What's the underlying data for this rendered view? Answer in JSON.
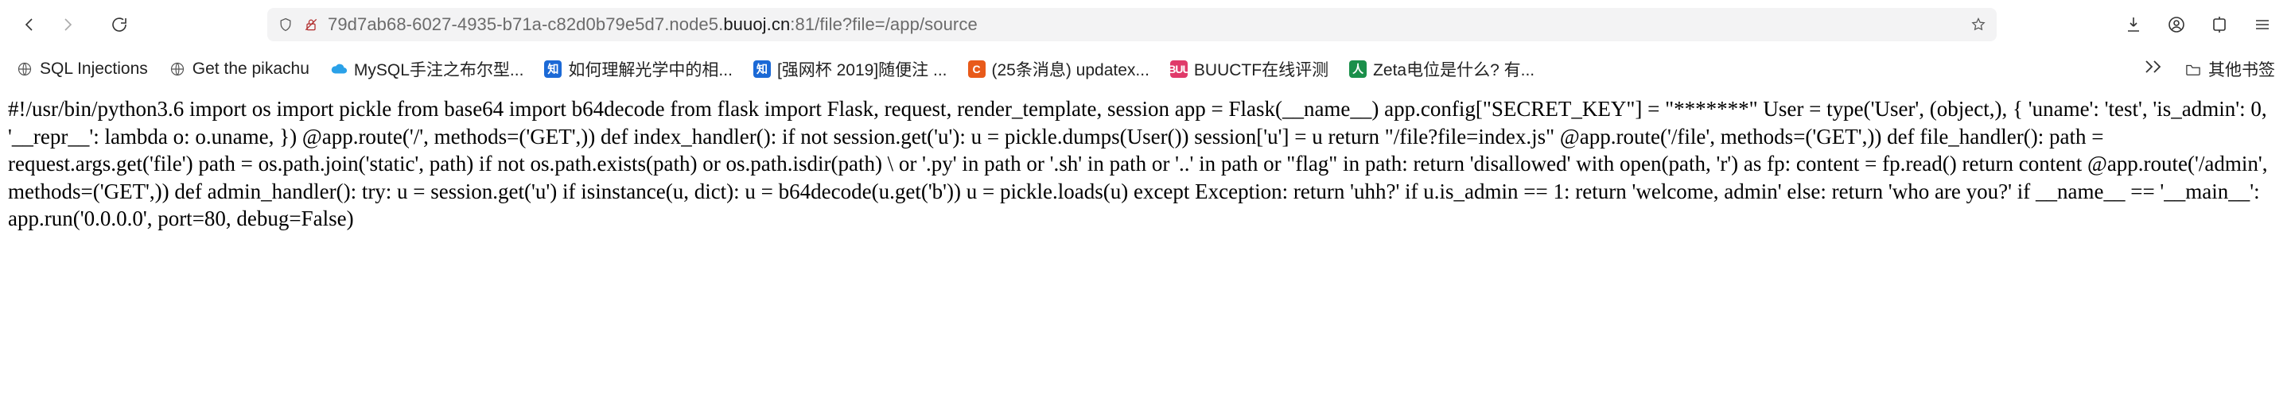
{
  "url": {
    "pre_host": "79d7ab68-6027-4935-b71a-c82d0b79e5d7.node5.",
    "host": "buuoj.cn",
    "post_host": ":81/file?file=/app/source"
  },
  "bookmarks": [
    {
      "label": "SQL Injections",
      "favicon": "globe"
    },
    {
      "label": "Get the pikachu",
      "favicon": "globe"
    },
    {
      "label": "MySQL手注之布尔型...",
      "favicon": "cloud"
    },
    {
      "label": "如何理解光学中的相...",
      "favicon": "blue",
      "glyph": "知"
    },
    {
      "label": "[强网杯 2019]随便注 ...",
      "favicon": "blue",
      "glyph": "知"
    },
    {
      "label": "(25条消息) updatex...",
      "favicon": "orange",
      "glyph": "C"
    },
    {
      "label": "BUUCTF在线评测",
      "favicon": "pink",
      "glyph": "BUU"
    },
    {
      "label": "Zeta电位是什么? 有...",
      "favicon": "green",
      "glyph": "人"
    }
  ],
  "other_bookmarks_label": "其他书签",
  "page_body": "#!/usr/bin/python3.6 import os import pickle from base64 import b64decode from flask import Flask, request, render_template, session app = Flask(__name__) app.config[\"SECRET_KEY\"] = \"*******\" User = type('User', (object,), { 'uname': 'test', 'is_admin': 0, '__repr__': lambda o: o.uname, }) @app.route('/', methods=('GET',)) def index_handler(): if not session.get('u'): u = pickle.dumps(User()) session['u'] = u return \"/file?file=index.js\" @app.route('/file', methods=('GET',)) def file_handler(): path = request.args.get('file') path = os.path.join('static', path) if not os.path.exists(path) or os.path.isdir(path) \\ or '.py' in path or '.sh' in path or '..' in path or \"flag\" in path: return 'disallowed' with open(path, 'r') as fp: content = fp.read() return content @app.route('/admin', methods=('GET',)) def admin_handler(): try: u = session.get('u') if isinstance(u, dict): u = b64decode(u.get('b')) u = pickle.loads(u) except Exception: return 'uhh?' if u.is_admin == 1: return 'welcome, admin' else: return 'who are you?' if __name__ == '__main__': app.run('0.0.0.0', port=80, debug=False)"
}
